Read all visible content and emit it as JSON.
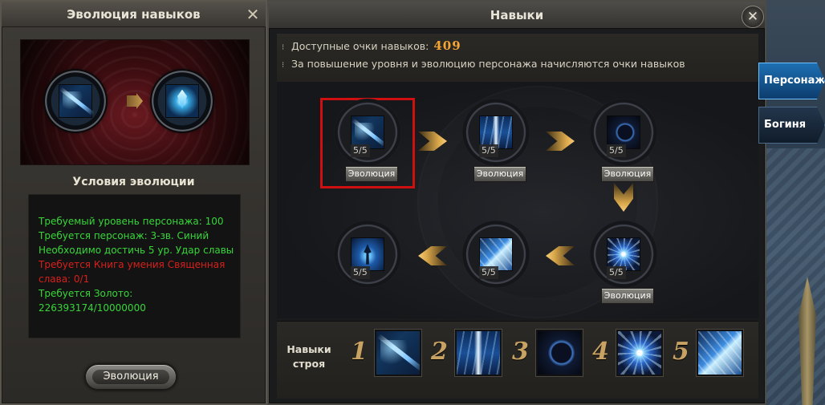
{
  "evolution_panel": {
    "title": "Эволюция навыков",
    "conditions_title": "Условия эволюции",
    "conditions": [
      {
        "text": "Требуемый уровень персонажа: 100",
        "status": "met"
      },
      {
        "text": "Требуется персонаж: 3-зв. Синий",
        "status": "met"
      },
      {
        "text": "Необходимо достичь 5 ур. Удар славы",
        "status": "met"
      },
      {
        "text": "Требуется Книга умения Священная",
        "status": "unmet"
      },
      {
        "text": "слава: 0/1",
        "status": "unmet"
      },
      {
        "text": "Требуется  Золото:",
        "status": "met"
      },
      {
        "text": "226393174/10000000",
        "status": "met"
      }
    ],
    "evolve_button": "Эволюция",
    "from_icon": "sword-skill-icon",
    "to_icon": "crystal-skill-icon"
  },
  "skills_panel": {
    "title": "Навыки",
    "available_points_label": "Доступные очки навыков:",
    "available_points": "409",
    "hint": "За повышение уровня и эволюцию персонажа начисляются очки навыков",
    "nodes": [
      {
        "level": "5/5",
        "evolve_label": "Эволюция",
        "icon": "sword-skill-icon",
        "selected": true
      },
      {
        "level": "5/5",
        "evolve_label": "Эволюция",
        "icon": "lightning-skill-icon",
        "selected": false
      },
      {
        "level": "5/5",
        "evolve_label": "Эволюция",
        "icon": "orb-skill-icon",
        "selected": false
      },
      {
        "level": "5/5",
        "evolve_label": "Эволюция",
        "icon": "burst-skill-icon",
        "selected": false
      },
      {
        "level": "5/5",
        "evolve_label": "",
        "icon": "shards-skill-icon",
        "selected": false
      },
      {
        "level": "5/5",
        "evolve_label": "",
        "icon": "figure-skill-icon",
        "selected": false
      }
    ],
    "formation": {
      "label_line1": "Навыки",
      "label_line2": "строя",
      "slots": [
        {
          "num": "1",
          "icon": "sword-skill-icon"
        },
        {
          "num": "2",
          "icon": "lightning-skill-icon"
        },
        {
          "num": "3",
          "icon": "orb-skill-icon"
        },
        {
          "num": "4",
          "icon": "burst-skill-icon"
        },
        {
          "num": "5",
          "icon": "shards-skill-icon"
        }
      ]
    }
  },
  "side_tabs": [
    "Персонаж",
    "Богиня"
  ],
  "colors": {
    "points": "#f4a535",
    "met": "#38d63a",
    "unmet": "#d7201c",
    "selection": "#d01010",
    "tab_active": "#1d6fb2"
  }
}
